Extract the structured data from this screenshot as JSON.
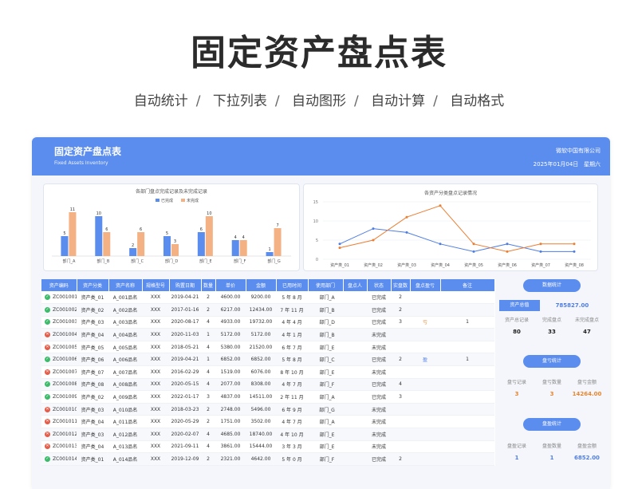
{
  "hero": {
    "title": "固定资产盘点表",
    "features": [
      "自动统计",
      "下拉列表",
      "自动图形",
      "自动计算",
      "自动格式"
    ],
    "sep": "/"
  },
  "header": {
    "title": "固定资产盘点表",
    "subtitle": "Fixed Assets Inventory",
    "company": "微软中国有限公司",
    "date": "2025年01月04日",
    "weekday": "星期六"
  },
  "colors": {
    "accent": "#5b8def",
    "orange": "#f4b183",
    "line_orange": "#ed7d31",
    "line_blue": "#4f7ee3"
  },
  "chart_data": [
    {
      "type": "bar",
      "title": "各部门盘点完成记录及未完成记录",
      "categories": [
        "部门_A",
        "部门_B",
        "部门_C",
        "部门_D",
        "部门_E",
        "部门_F",
        "部门_G"
      ],
      "series": [
        {
          "name": "已完成",
          "values": [
            5,
            10,
            2,
            5,
            6,
            4,
            1
          ]
        },
        {
          "name": "未完成",
          "values": [
            11,
            6,
            6,
            3,
            10,
            4,
            7
          ]
        }
      ],
      "ylim": [
        0,
        12
      ],
      "legend": "top"
    },
    {
      "type": "line",
      "title": "各资产分类盘点记录情况",
      "categories": [
        "资产类_01",
        "资产类_02",
        "资产类_03",
        "资产类_04",
        "资产类_05",
        "资产类_06",
        "资产类_07",
        "资产类_08"
      ],
      "series": [
        {
          "name": "blue",
          "values": [
            4,
            8,
            7,
            4,
            2,
            4,
            2,
            2
          ]
        },
        {
          "name": "orange",
          "values": [
            3,
            5,
            11,
            14,
            4,
            2,
            4,
            4
          ]
        }
      ],
      "yticks": [
        0,
        5,
        10,
        15
      ],
      "ylim": [
        0,
        15
      ],
      "grid": true
    }
  ],
  "table": {
    "headers": [
      "资产编码",
      "资产分类",
      "资产名称",
      "规格型号",
      "购置日期",
      "数量",
      "单价",
      "金额",
      "已用时间",
      "使用部门",
      "盘点人",
      "状态",
      "实盘数",
      "盘点盈亏",
      "备注"
    ],
    "rows": [
      [
        "ok",
        "ZC001001",
        "资产类_01",
        "A_001品名",
        "XXX",
        "2019-04-21",
        "2",
        "4600.00",
        "9200.00",
        "5 年 8 月",
        "部门_A",
        "",
        "已完成",
        "2",
        "",
        ""
      ],
      [
        "ok",
        "ZC001002",
        "资产类_02",
        "A_002品名",
        "XXX",
        "2017-01-16",
        "2",
        "6217.00",
        "12434.00",
        "7 年 11 月",
        "部门_B",
        "",
        "已完成",
        "2",
        "",
        ""
      ],
      [
        "ok",
        "ZC001003",
        "资产类_03",
        "A_003品名",
        "XXX",
        "2020-08-17",
        "4",
        "4933.00",
        "19732.00",
        "4 年 4 月",
        "部门_D",
        "",
        "已完成",
        "3",
        "亏",
        "1"
      ],
      [
        "no",
        "ZC001004",
        "资产类_04",
        "A_004品名",
        "XXX",
        "2020-11-03",
        "1",
        "5172.00",
        "5172.00",
        "4 年 1 月",
        "部门_B",
        "",
        "未完成",
        "",
        "",
        ""
      ],
      [
        "no",
        "ZC001005",
        "资产类_05",
        "A_005品名",
        "XXX",
        "2018-05-21",
        "4",
        "5380.00",
        "21520.00",
        "6 年 7 月",
        "部门_E",
        "",
        "未完成",
        "",
        "",
        ""
      ],
      [
        "ok",
        "ZC001006",
        "资产类_06",
        "A_006品名",
        "XXX",
        "2019-04-21",
        "1",
        "6852.00",
        "6852.00",
        "5 年 8 月",
        "部门_C",
        "",
        "已完成",
        "2",
        "盈",
        "1"
      ],
      [
        "no",
        "ZC001007",
        "资产类_07",
        "A_007品名",
        "XXX",
        "2016-02-29",
        "4",
        "1519.00",
        "6076.00",
        "8 年 10 月",
        "部门_E",
        "",
        "未完成",
        "",
        "",
        ""
      ],
      [
        "ok",
        "ZC001008",
        "资产类_08",
        "A_008品名",
        "XXX",
        "2020-05-15",
        "4",
        "2077.00",
        "8308.00",
        "4 年 7 月",
        "部门_F",
        "",
        "已完成",
        "4",
        "",
        ""
      ],
      [
        "ok",
        "ZC001009",
        "资产类_02",
        "A_009品名",
        "XXX",
        "2022-01-17",
        "3",
        "4837.00",
        "14511.00",
        "2 年 11 月",
        "部门_A",
        "",
        "已完成",
        "3",
        "",
        ""
      ],
      [
        "no",
        "ZC001010",
        "资产类_03",
        "A_010品名",
        "XXX",
        "2018-03-23",
        "2",
        "2748.00",
        "5496.00",
        "6 年 9 月",
        "部门_G",
        "",
        "未完成",
        "",
        "",
        ""
      ],
      [
        "no",
        "ZC001011",
        "资产类_04",
        "A_011品名",
        "XXX",
        "2020-05-29",
        "2",
        "1751.00",
        "3502.00",
        "4 年 7 月",
        "部门_A",
        "",
        "未完成",
        "",
        "",
        ""
      ],
      [
        "no",
        "ZC001012",
        "资产类_03",
        "A_012品名",
        "XXX",
        "2020-02-07",
        "4",
        "4685.00",
        "18740.00",
        "4 年 10 月",
        "部门_E",
        "",
        "未完成",
        "",
        "",
        ""
      ],
      [
        "no",
        "ZC001013",
        "资产类_04",
        "A_013品名",
        "XXX",
        "2021-09-11",
        "4",
        "3861.00",
        "15444.00",
        "3 年 3 月",
        "部门_E",
        "",
        "未完成",
        "",
        "",
        ""
      ],
      [
        "ok",
        "ZC001014",
        "资产类_01",
        "A_014品名",
        "XXX",
        "2019-12-09",
        "2",
        "2321.00",
        "4642.00",
        "5 年 0 月",
        "部门_F",
        "",
        "已完成",
        "2",
        "",
        ""
      ]
    ]
  },
  "side": {
    "stats_button": "数据统计",
    "total_label": "资产总值",
    "total_value": "785827.00",
    "count_labels": [
      "资产总记录",
      "完成盘点",
      "未完成盘点"
    ],
    "count_values": [
      "80",
      "33",
      "47"
    ],
    "loss_button": "盘亏统计",
    "loss_labels": [
      "盘亏记录",
      "盘亏数量",
      "盘亏金额"
    ],
    "loss_values": [
      "3",
      "3",
      "14264.00"
    ],
    "gain_button": "盘盈统计",
    "gain_labels": [
      "盘盈记录",
      "盘盈数量",
      "盘盈金额"
    ],
    "gain_values": [
      "1",
      "1",
      "6852.00"
    ]
  }
}
